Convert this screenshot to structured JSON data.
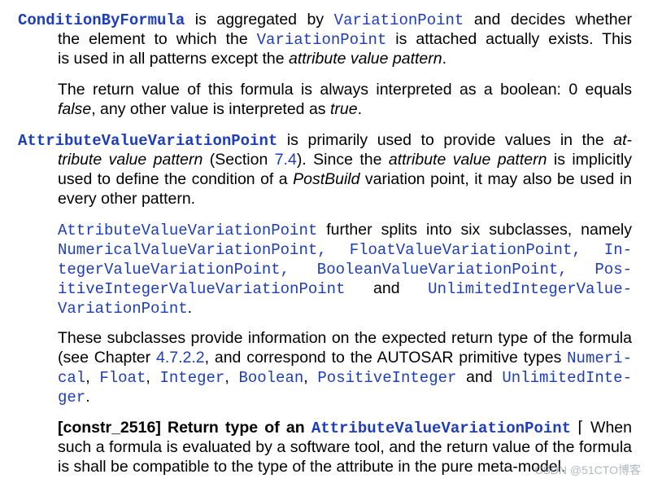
{
  "p1": {
    "l1": {
      "term": "ConditionByFormula",
      "t1": " is aggregated by ",
      "c1": "VariationPoint",
      "t2": " and decides whether"
    },
    "l2": {
      "t1": "the element to which the ",
      "c1": "VariationPoint",
      "t2": " is attached actually exists.  This"
    },
    "l3": {
      "t1": "is used in all patterns except the ",
      "em": "attribute value pattern",
      "t2": "."
    }
  },
  "p2": {
    "l1": {
      "t1": "The return value of this formula is always interpreted as a boolean: 0 equals"
    },
    "l2": {
      "em1": "false",
      "t1": ", any other value is interpreted as ",
      "em2": "true",
      "t2": "."
    }
  },
  "p3": {
    "l1": {
      "term": "AttributeValueVariationPoint",
      "t1": " is primarily used to provide values in the ",
      "em": "at-"
    },
    "l2": {
      "em1": "tribute value pattern",
      "t1": " (Section ",
      "link": "7.4",
      "t2": ").  Since the ",
      "em2": "attribute value pattern",
      "t3": " is implicitly"
    },
    "l3": {
      "t1": "used to define the condition of a ",
      "em": "PostBuild",
      "t2": " variation point, it may also be used in"
    },
    "l4": {
      "t1": "every other pattern."
    }
  },
  "p4": {
    "l1": {
      "c1": "AttributeValueVariationPoint",
      "t1": " further splits into six subclasses, namely"
    },
    "l2": {
      "c1": "NumericalValueVariationPoint,",
      "c2": "FloatValueVariationPoint,",
      "c3": "In-"
    },
    "l3": {
      "c1": "tegerValueVariationPoint,",
      "c2": "BooleanValueVariationPoint,",
      "c3": "Pos-"
    },
    "l4": {
      "c1": "itiveIntegerValueVariationPoint",
      "t1": "and",
      "c2": "UnlimitedIntegerValue-"
    },
    "l5": {
      "c1": "VariationPoint",
      "t1": "."
    }
  },
  "p5": {
    "l1": {
      "t1": "These subclasses provide information on the expected return type of the formula"
    },
    "l2": {
      "t1": "(see Chapter ",
      "link": "4.7.2.2",
      "t2": ", and correspond to the AUTOSAR primitive types ",
      "c1": "Numeri-"
    },
    "l3": {
      "c1": "cal",
      "t1": ", ",
      "c2": "Float",
      "t2": ", ",
      "c3": "Integer",
      "t3": ", ",
      "c4": "Boolean",
      "t4": ", ",
      "c5": "PositiveInteger",
      "t5": " and ",
      "c6": "UnlimitedInte-"
    },
    "l4": {
      "c1": "ger",
      "t1": "."
    }
  },
  "p6": {
    "l1": {
      "b1": "[constr_2516] Return type of an ",
      "term": "AttributeValueVariationPoint",
      "t1": " ⌈ When"
    },
    "l2": {
      "t1": "such a formula is evaluated by a software tool, and the return value of the formula"
    },
    "l3": {
      "t1": "is shall be compatible to the type of the attribute in the pure meta-model."
    }
  },
  "watermark": "CSDN @51CTO博客"
}
